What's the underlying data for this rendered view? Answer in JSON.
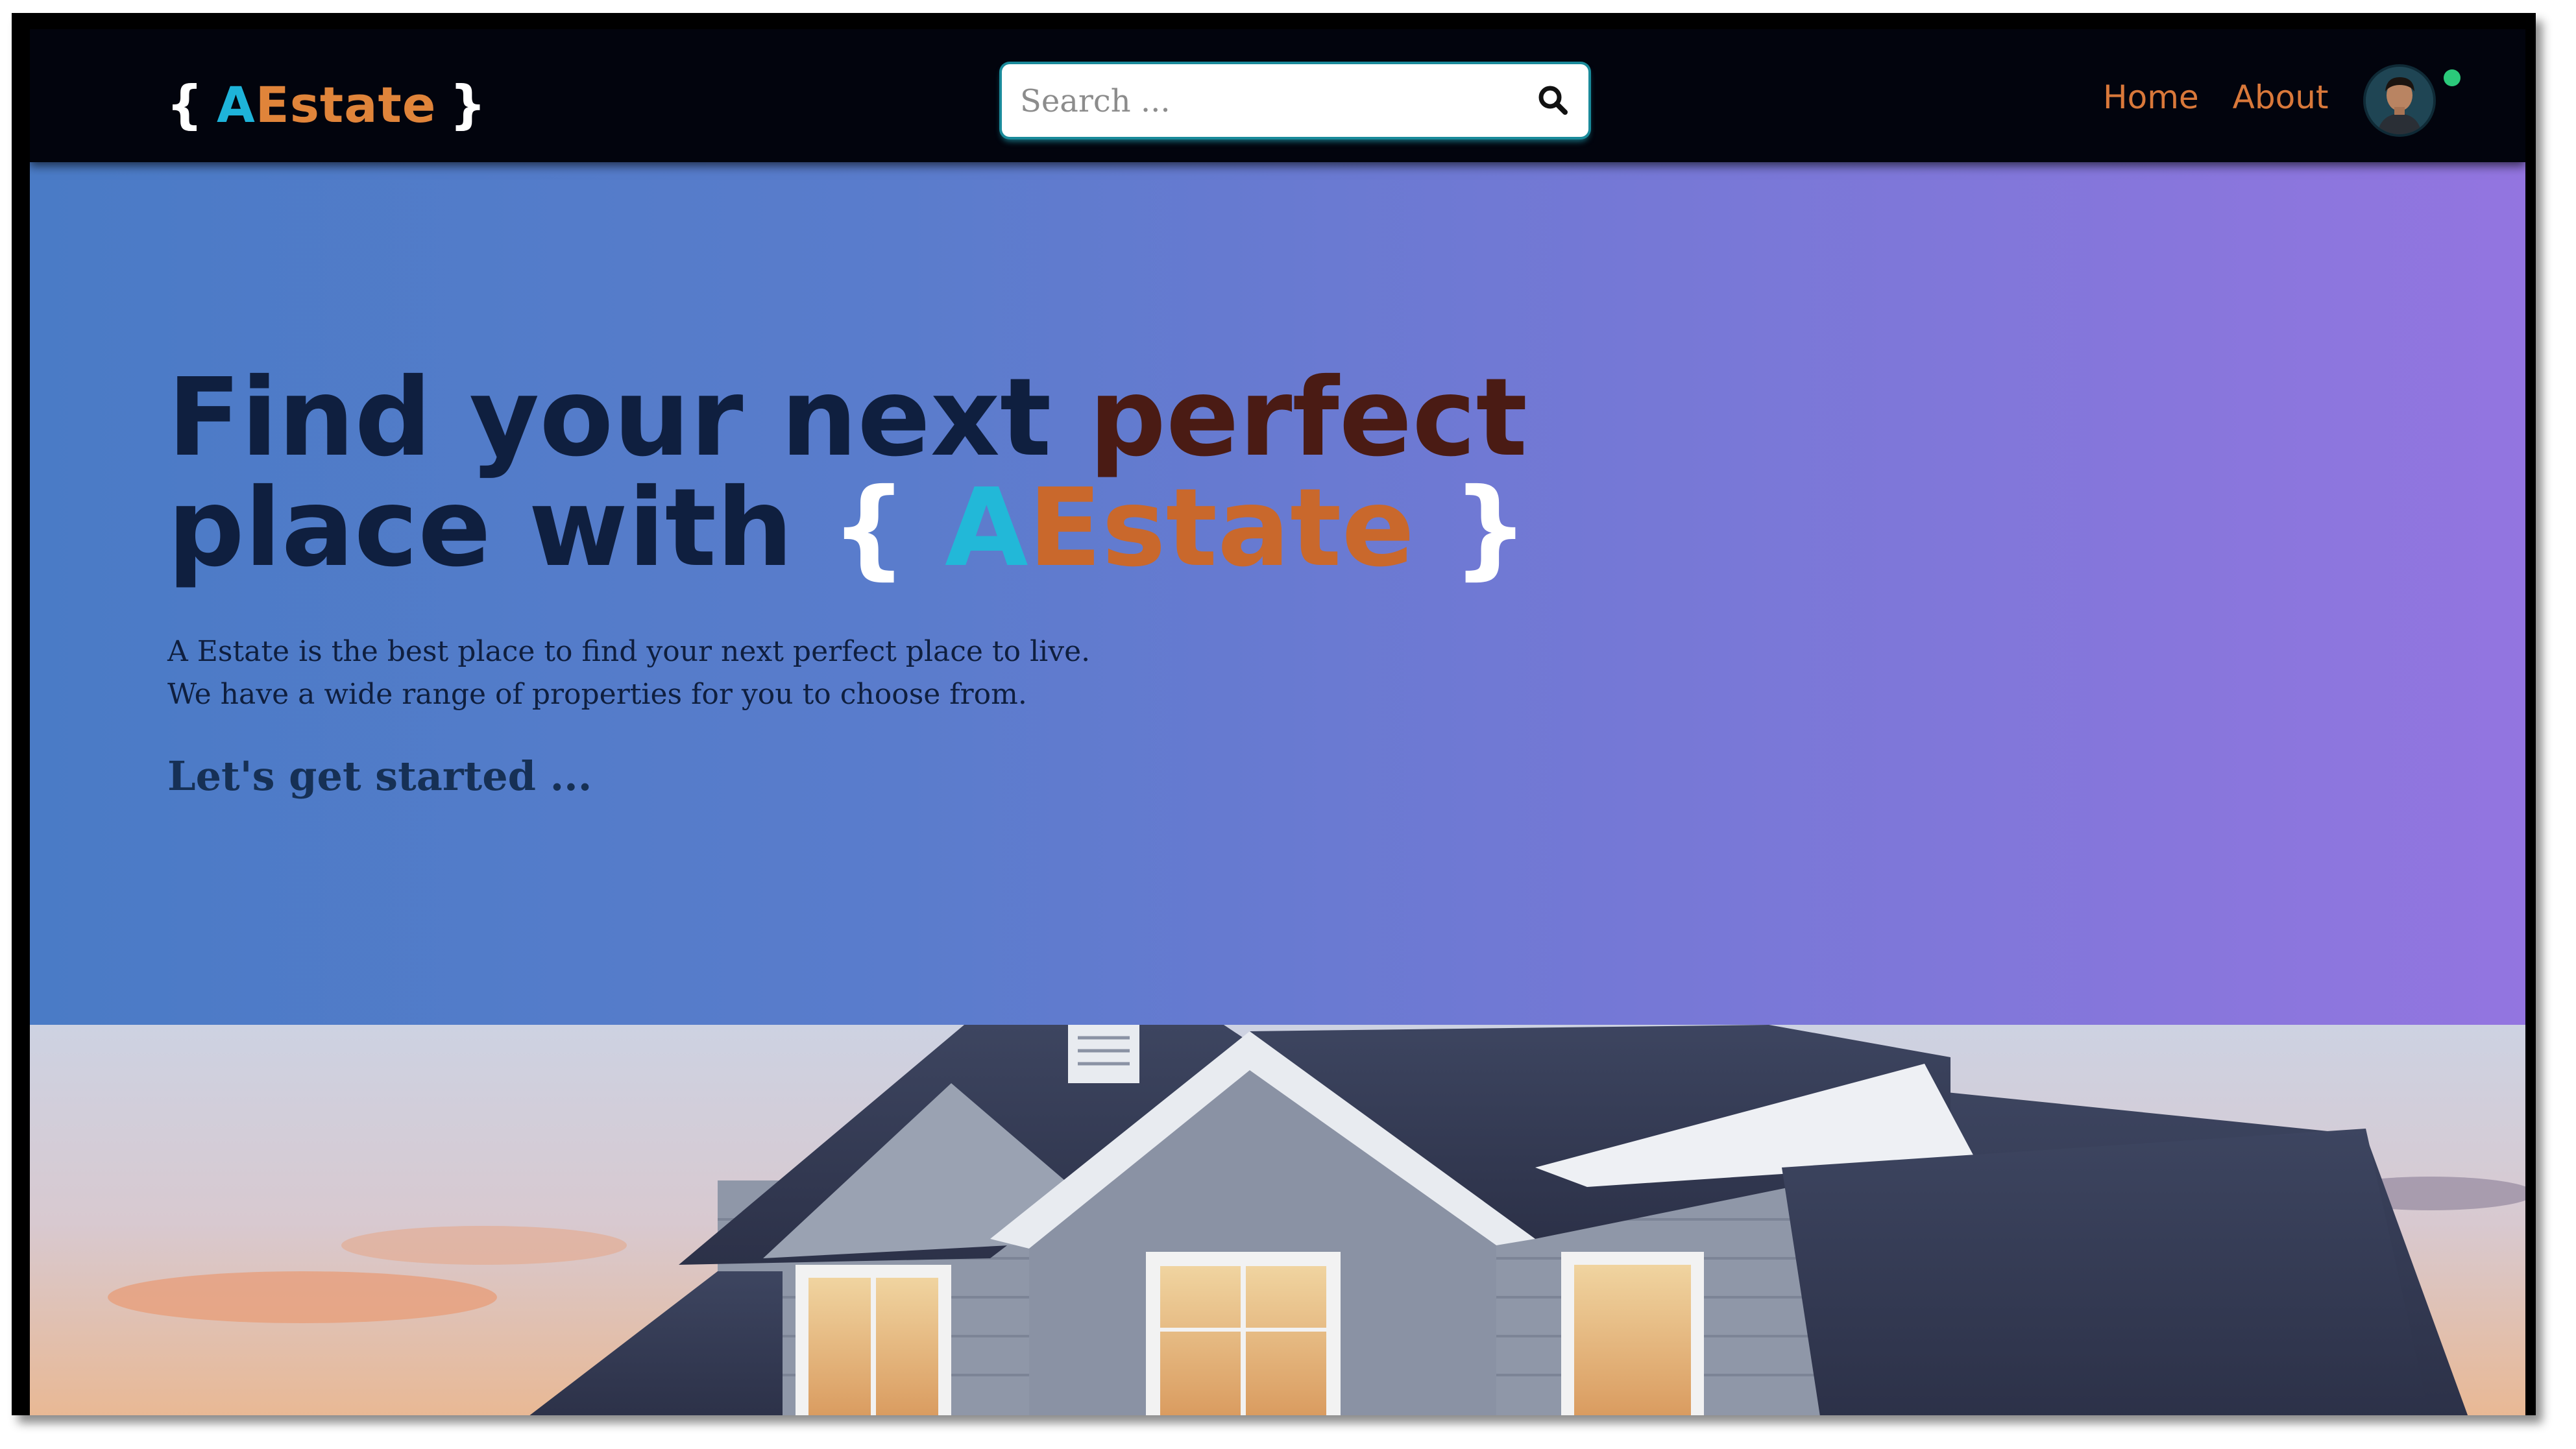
{
  "navbar": {
    "logo": {
      "open_brace": "{",
      "a": "A",
      "estate": "Estate",
      "close_brace": "}"
    },
    "search": {
      "placeholder": "Search ...",
      "icon": "search-icon"
    },
    "links": [
      {
        "label": "Home"
      },
      {
        "label": "About"
      }
    ],
    "avatar": {
      "icon": "user-avatar",
      "status": "online"
    }
  },
  "hero": {
    "title_line1_main": "Find your next ",
    "title_line1_accent": "perfect",
    "title_line2_main": "place with ",
    "title_brand": {
      "open_brace": "{",
      "a": "A",
      "estate": "Estate",
      "close_brace": "}"
    },
    "description_line1": "A Estate is the best place to find your next perfect place to live.",
    "description_line2": "We have a wide range of properties for you to choose from.",
    "cta": "Let's get started ..."
  },
  "colors": {
    "navbar_bg": "#02040d",
    "nav_link": "#d9783a",
    "brand_cyan": "#1eb3d9",
    "brand_orange": "#e0843a",
    "hero_gradient_start": "#4a7bc6",
    "hero_gradient_end": "#9375e0",
    "title_dark": "#0f1f3f",
    "title_accent": "#4a1b14",
    "status_dot": "#2bc97a"
  }
}
